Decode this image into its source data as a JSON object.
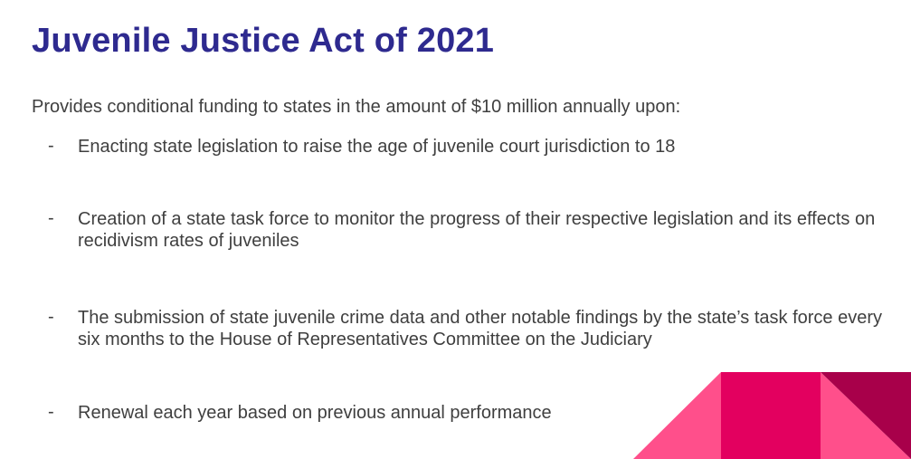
{
  "slide": {
    "title": "Juvenile Justice Act of 2021",
    "intro": "Provides conditional funding to states in the amount of $10 million annually upon:",
    "bullets": [
      {
        "marker": "-",
        "text": "Enacting state legislation to raise the age of juvenile court jurisdiction to 18"
      },
      {
        "marker": "-",
        "text": "Creation of a state task force to monitor the progress of their respective legislation and its effects on recidivism rates of juveniles"
      },
      {
        "marker": "-",
        "text": "The submission of state juvenile crime data and other notable findings by the state’s task force every six months to the House of Representatives Committee on the Judiciary"
      },
      {
        "marker": "-",
        "text": "Renewal each year based on previous annual performance"
      }
    ]
  },
  "colors": {
    "title": "#2e2a8f",
    "body_text": "#3f3f3f",
    "deco_pink": "#ff4f8b",
    "deco_magenta": "#e3005f",
    "deco_dark": "#a8004a"
  }
}
